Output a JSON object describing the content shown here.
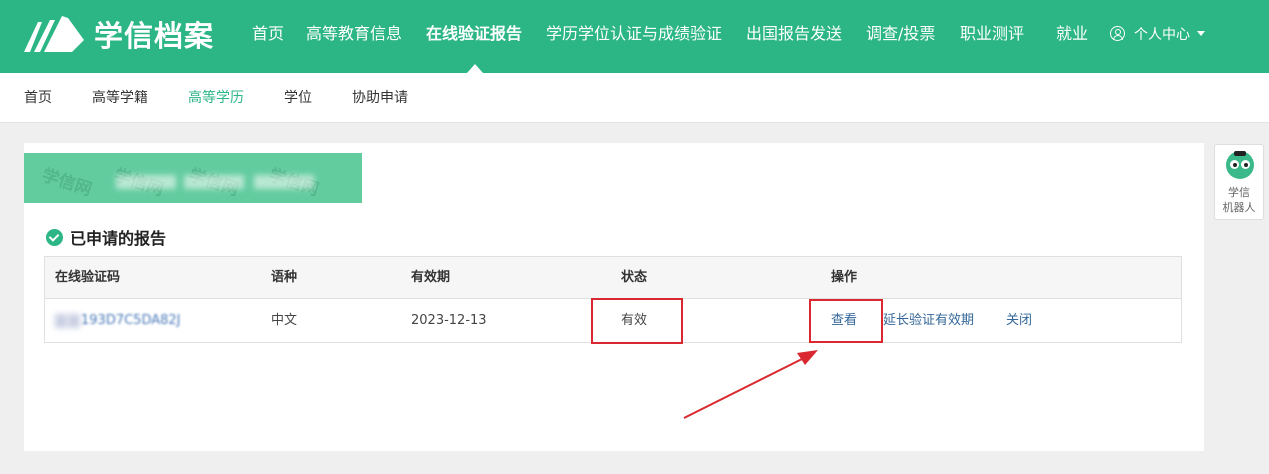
{
  "header": {
    "logo_text": "学信档案",
    "nav": [
      {
        "label": "首页"
      },
      {
        "label": "高等教育信息"
      },
      {
        "label": "在线验证报告",
        "active": true
      },
      {
        "label": "学历学位认证与成绩验证"
      },
      {
        "label": "出国报告发送"
      },
      {
        "label": "调查/投票"
      },
      {
        "label": "职业测评"
      },
      {
        "label": "就业"
      }
    ],
    "user_center": "个人中心"
  },
  "subnav": {
    "items": [
      {
        "label": "首页"
      },
      {
        "label": "高等学籍"
      },
      {
        "label": "高等学历",
        "active": true
      },
      {
        "label": "学位"
      },
      {
        "label": "协助申请"
      }
    ]
  },
  "banner": {
    "watermark": "学信网"
  },
  "section": {
    "title": "已申请的报告"
  },
  "table": {
    "columns": [
      "在线验证码",
      "语种",
      "有效期",
      "状态",
      "操作"
    ],
    "rows": [
      {
        "code_visible": "193D7C5DA82J",
        "language": "中文",
        "expiry": "2023-12-13",
        "status": "有效",
        "actions": [
          "查看",
          "延长验证有效期",
          "关闭"
        ]
      }
    ]
  },
  "robot": {
    "label_line1": "学信",
    "label_line2": "机器人"
  },
  "colors": {
    "brand_green": "#2cb686",
    "link_blue": "#336699",
    "annotation_red": "#d9282f"
  }
}
